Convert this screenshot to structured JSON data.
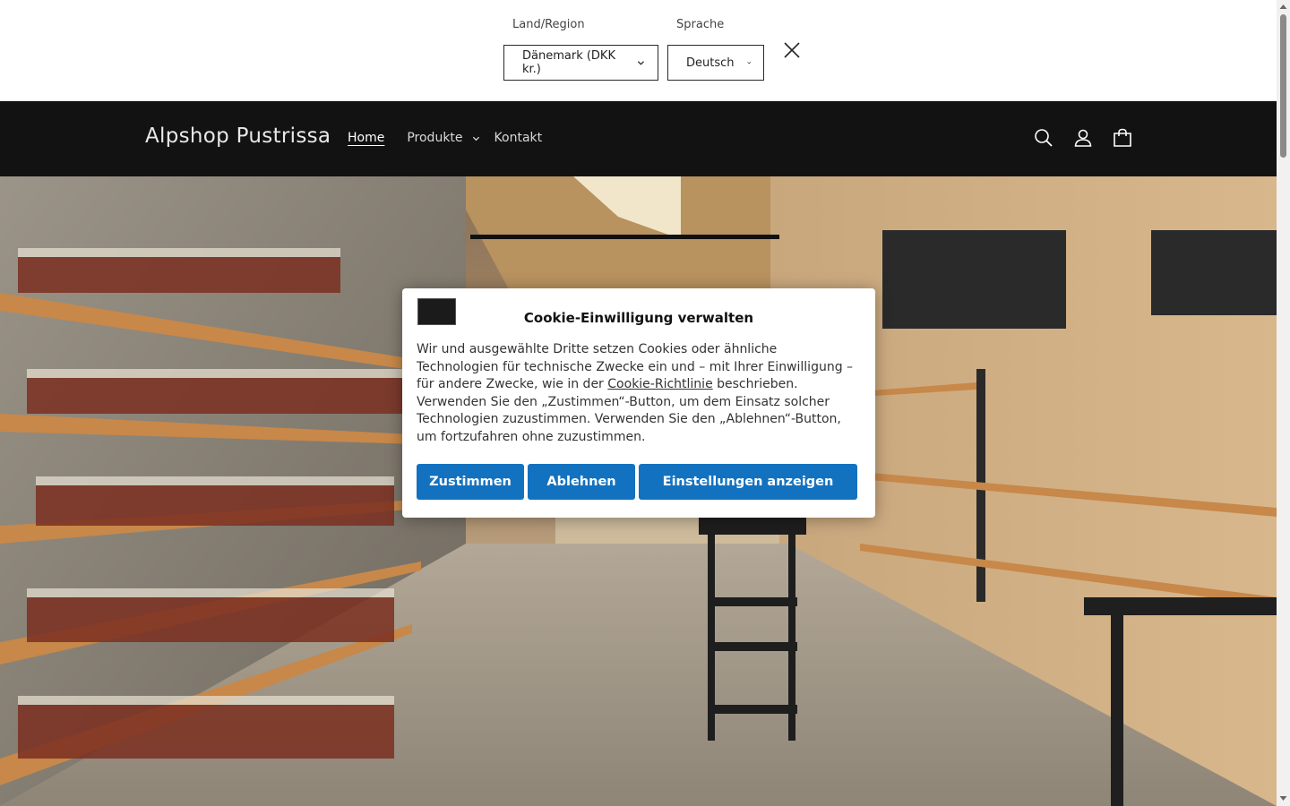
{
  "localization": {
    "country_label": "Land/Region",
    "country_value": "Dänemark (DKK kr.)",
    "language_label": "Sprache",
    "language_value": "Deutsch"
  },
  "header": {
    "brand": "Alpshop Pustrissa",
    "nav": [
      "Home",
      "Produkte",
      "Kontakt"
    ]
  },
  "icons": [
    "close-icon",
    "search-icon",
    "account-icon",
    "cart-icon",
    "chevron-down-icon"
  ],
  "cookie": {
    "title": "Cookie-Einwilligung verwalten",
    "text_before_link": "Wir und ausgewählte Dritte setzen Cookies oder ähnliche Technologien für technische Zwecke ein und – mit Ihrer Einwilligung – für andere Zwecke, wie in der ",
    "link_text": "Cookie-Richtlinie",
    "text_after_link": " beschrieben. Verwenden Sie den „Zustimmen“-Button, um dem Einsatz solcher Technologien zuzustimmen. Verwenden Sie den „Ablehnen“-Button, um fortzufahren ohne zuzustimmen.",
    "buttons": [
      "Zustimmen",
      "Ablehnen",
      "Einstellungen anzeigen"
    ]
  },
  "colors": {
    "header_bg": "#121212",
    "button_bg": "#1372c0"
  }
}
